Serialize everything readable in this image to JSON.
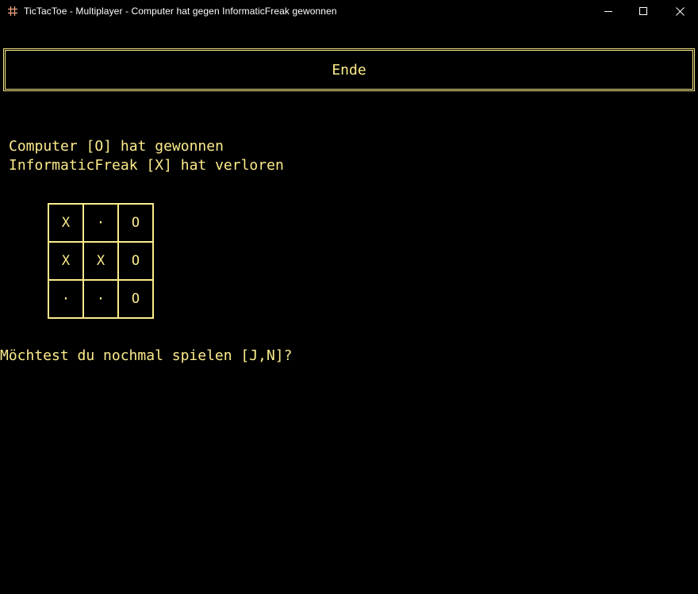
{
  "window": {
    "title": "TicTacToe - Multiplayer - Computer hat gegen InformaticFreak gewonnen",
    "app_icon": "hash-icon",
    "controls": [
      "minimize-icon",
      "maximize-icon",
      "close-icon"
    ]
  },
  "header": {
    "label": "Ende"
  },
  "result": {
    "winner_line": "Computer [O] hat gewonnen",
    "loser_line": "InformaticFreak [X] hat verloren"
  },
  "board": {
    "cells": [
      [
        "X",
        "·",
        "O"
      ],
      [
        "X",
        "X",
        "O"
      ],
      [
        "·",
        "·",
        "O"
      ]
    ]
  },
  "prompt": {
    "text": "Möchtest du nochmal spielen [J,N]?"
  },
  "colors": {
    "background": "#000000",
    "console_text": "#fcec8c",
    "titlebar_text": "#ffffff",
    "icon_accent": "#e8a07a"
  }
}
